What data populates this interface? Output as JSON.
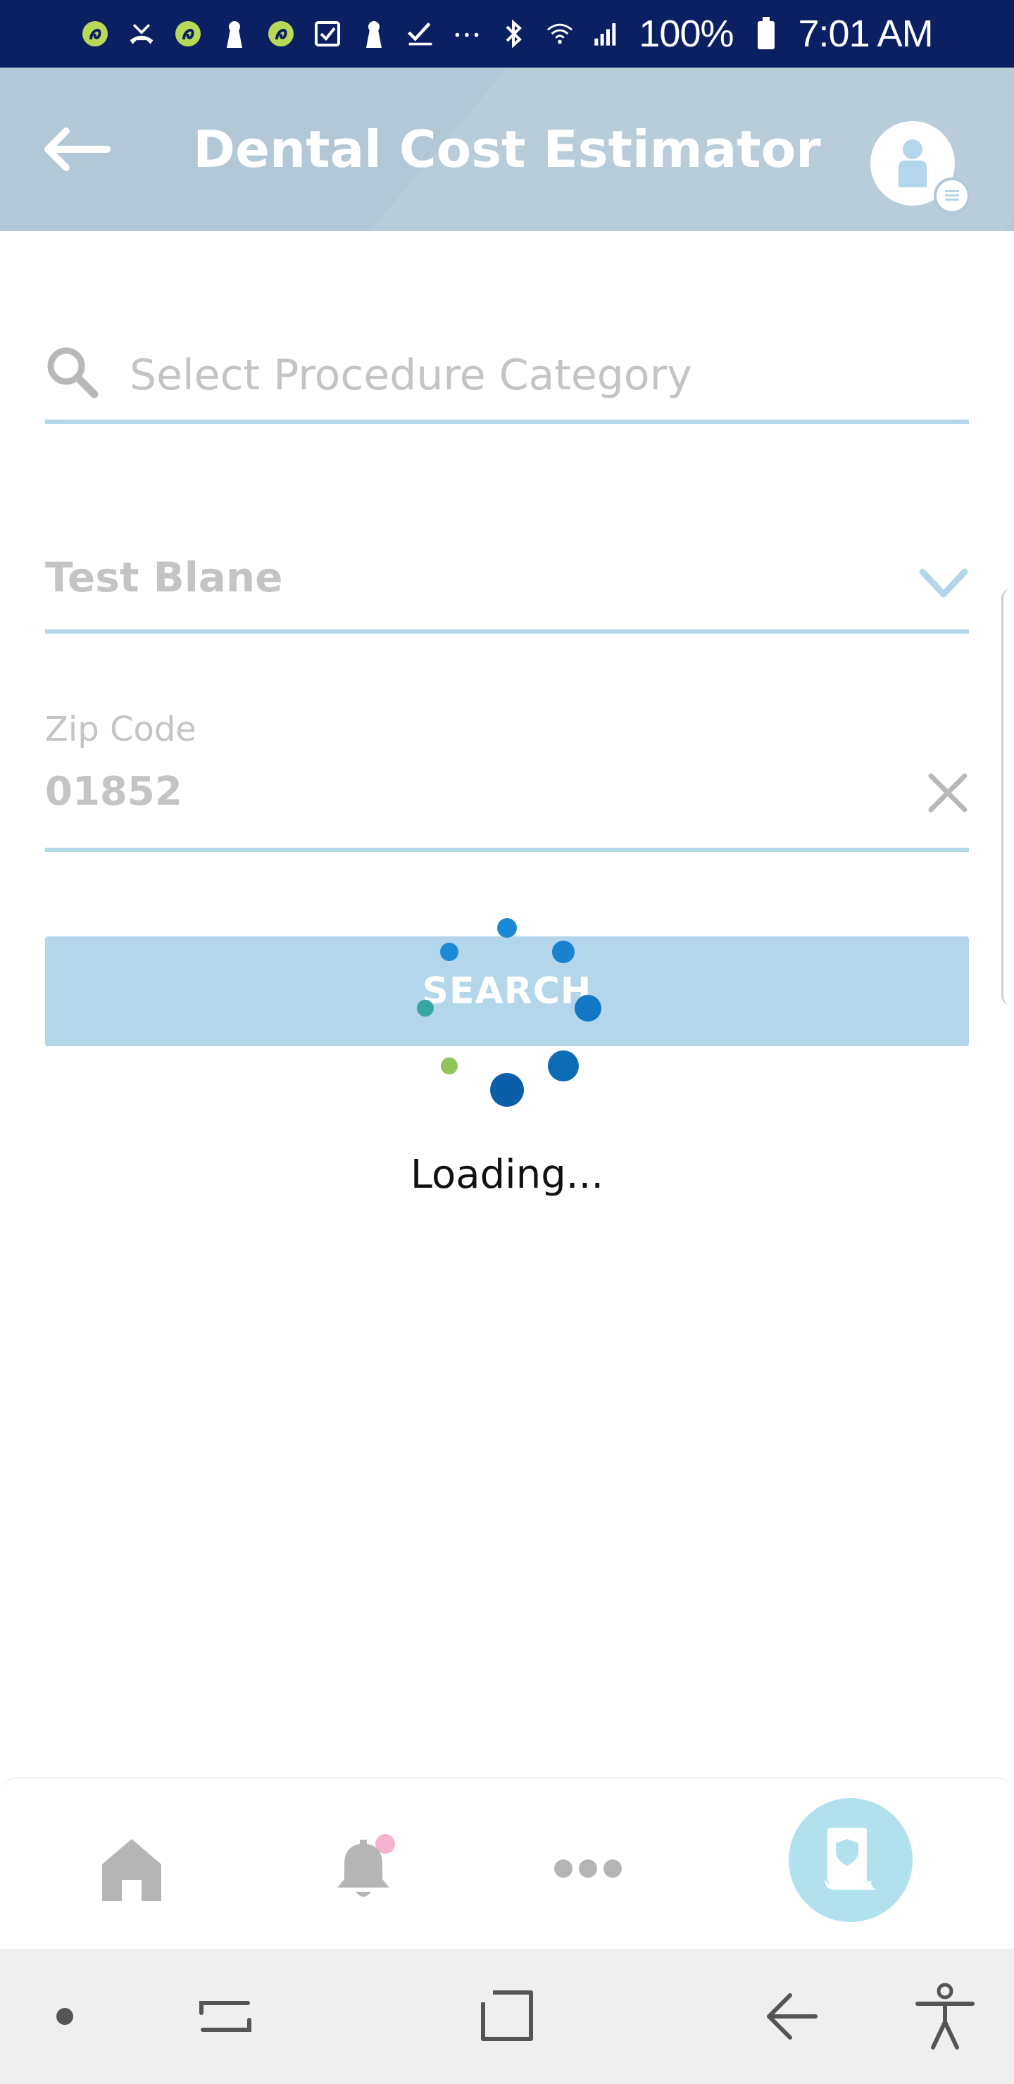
{
  "status_bar": {
    "battery": "100%",
    "time": "7:01 AM",
    "icons": [
      "app-notification-icon",
      "missed-call-icon",
      "app-notification-icon",
      "keyhole-icon",
      "app-notification-icon",
      "checkbox-icon",
      "keyhole-icon",
      "checkmark-icon",
      "more-dots-icon",
      "bluetooth-icon",
      "wifi-icon",
      "signal-icon",
      "battery-icon"
    ]
  },
  "header": {
    "title": "Dental Cost Estimator",
    "back_icon": "back-arrow-icon",
    "avatar_icon": "user-avatar-icon"
  },
  "form": {
    "procedure_search": {
      "placeholder": "Select Procedure Category",
      "value": ""
    },
    "plan_select": {
      "value": "Test Blane"
    },
    "zip": {
      "label": "Zip Code",
      "value": "01852"
    },
    "search_button_label": "SEARCH"
  },
  "loading": {
    "text": "Loading..."
  },
  "bottom_tabs": {
    "items": [
      {
        "icon": "home-icon"
      },
      {
        "icon": "bell-icon",
        "has_badge": true
      },
      {
        "icon": "more-icon"
      },
      {
        "icon": "insurance-card-icon",
        "active": true
      }
    ]
  },
  "nav_bar": {
    "items": [
      "dot-icon",
      "recent-apps-icon",
      "home-square-icon",
      "back-icon",
      "accessibility-icon"
    ]
  },
  "colors": {
    "status_bar": "#0b1f63",
    "header": "#b3c8d6",
    "accent": "#b3d6eb",
    "fab": "#b0e1ec",
    "badge": "#f5b3cf"
  }
}
